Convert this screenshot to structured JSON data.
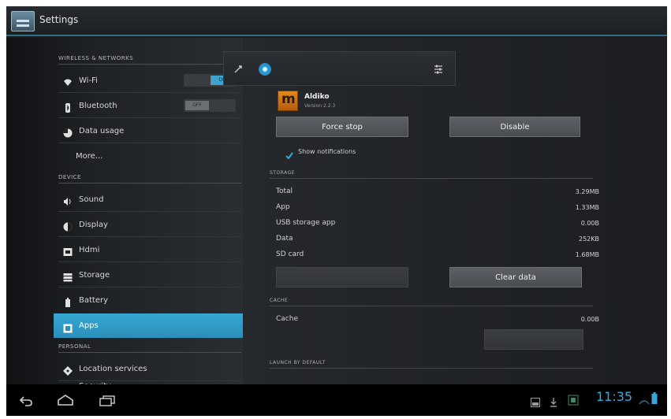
{
  "action_bar": {
    "title": "Settings"
  },
  "sidebar": {
    "wireless_header": "WIRELESS & NETWORKS",
    "device_header": "DEVICE",
    "personal_header": "PERSONAL",
    "items": [
      {
        "label": "Wi-Fi",
        "icon": "wifi-icon"
      },
      {
        "label": "Bluetooth",
        "icon": "bluetooth-icon"
      },
      {
        "label": "Data usage",
        "icon": "data-usage-icon"
      },
      {
        "label": "More..."
      },
      {
        "label": "Sound",
        "icon": "sound-icon"
      },
      {
        "label": "Display",
        "icon": "display-icon"
      },
      {
        "label": "Hdmi",
        "icon": "hdmi-icon"
      },
      {
        "label": "Storage",
        "icon": "storage-icon"
      },
      {
        "label": "Battery",
        "icon": "battery-icon"
      },
      {
        "label": "Apps",
        "icon": "apps-icon",
        "selected": true
      },
      {
        "label": "Location services",
        "icon": "location-icon"
      },
      {
        "label": "Security",
        "icon": "security-icon"
      }
    ],
    "wifi_toggle": "ON",
    "bluetooth_toggle": "OFF"
  },
  "app_info": {
    "name": "Aldiko",
    "version": "Version 2.2.3",
    "force_stop": "Force stop",
    "disable": "Disable",
    "show_notifications": "Show notifications",
    "show_notifications_checked": true
  },
  "storage": {
    "header": "STORAGE",
    "rows": [
      {
        "label": "Total",
        "value": "3.29MB"
      },
      {
        "label": "App",
        "value": "1.33MB"
      },
      {
        "label": "USB storage app",
        "value": "0.00B"
      },
      {
        "label": "Data",
        "value": "252KB"
      },
      {
        "label": "SD card",
        "value": "1.68MB"
      }
    ],
    "clear_data": "Clear data"
  },
  "cache": {
    "header": "CACHE",
    "label": "Cache",
    "value": "0.00B"
  },
  "launch": {
    "header": "LAUNCH BY DEFAULT"
  },
  "system_bar": {
    "clock": "11:35"
  },
  "colors": {
    "accent": "#33a3d6",
    "app_icon": "#d9771a"
  }
}
